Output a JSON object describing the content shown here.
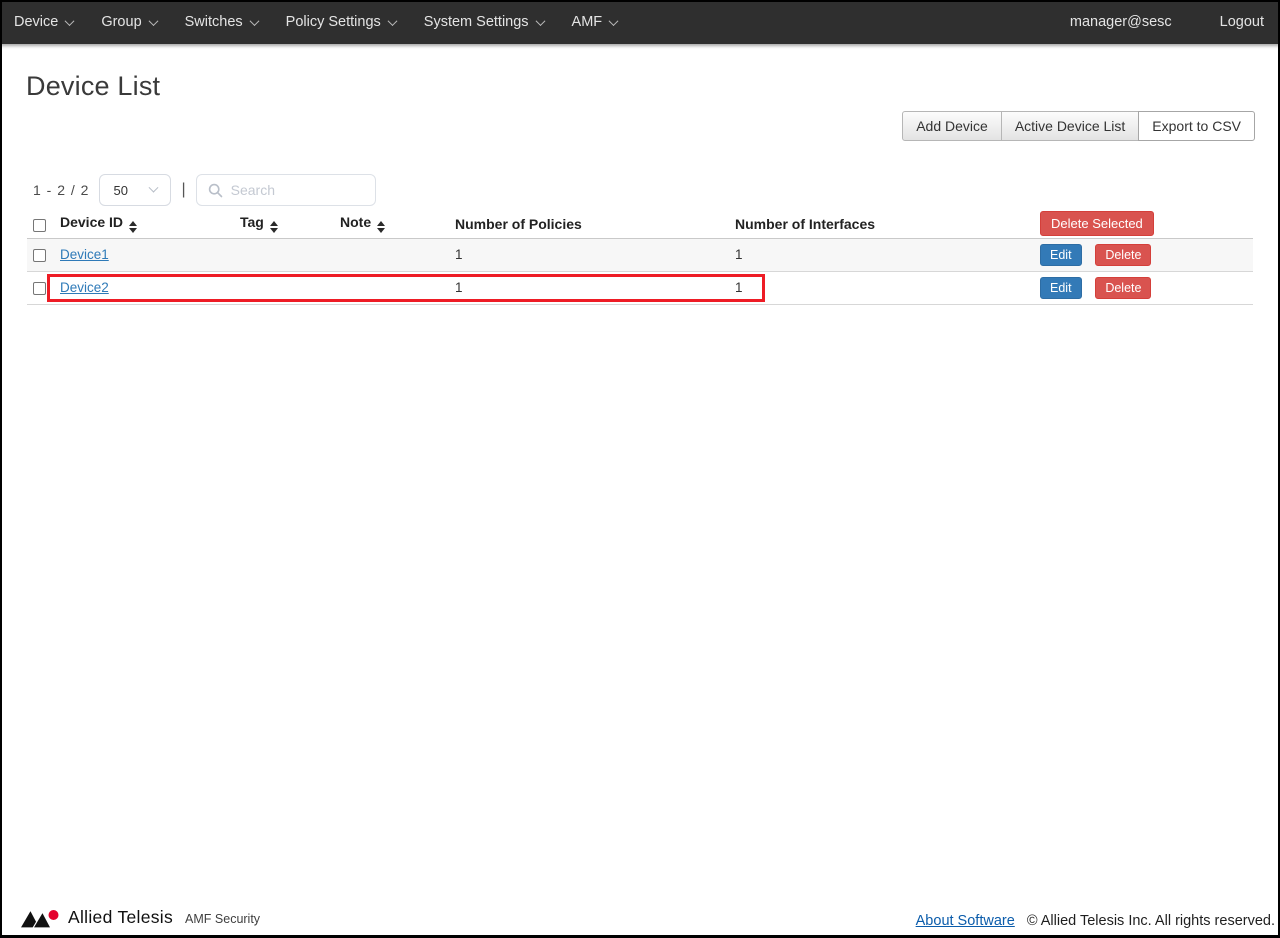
{
  "navbar": {
    "menus": [
      {
        "label": "Device"
      },
      {
        "label": "Group"
      },
      {
        "label": "Switches"
      },
      {
        "label": "Policy Settings"
      },
      {
        "label": "System Settings"
      },
      {
        "label": "AMF"
      }
    ],
    "user_email": "manager@sesc",
    "logout_label": "Logout"
  },
  "page": {
    "title": "Device List"
  },
  "toolbar": {
    "add_device_label": "Add Device",
    "active_device_list_label": "Active Device List",
    "export_csv_label": "Export to CSV"
  },
  "list_controls": {
    "range_text": "1 - 2 / 2",
    "page_size_value": "50",
    "separator": "|",
    "search_placeholder": "Search"
  },
  "table": {
    "headers": {
      "device_id": "Device ID",
      "tag": "Tag",
      "note": "Note",
      "policies": "Number of Policies",
      "interfaces": "Number of Interfaces"
    },
    "delete_selected_label": "Delete Selected",
    "rows": [
      {
        "device_id": "Device1",
        "tag": "",
        "note": "",
        "policies": "1",
        "interfaces": "1",
        "edit_label": "Edit",
        "delete_label": "Delete"
      },
      {
        "device_id": "Device2",
        "tag": "",
        "note": "",
        "policies": "1",
        "interfaces": "1",
        "edit_label": "Edit",
        "delete_label": "Delete"
      }
    ]
  },
  "annotation": {
    "highlighted_row": "Device2",
    "color": "#ee1c25"
  },
  "footer": {
    "brand": "Allied Telesis",
    "product": "AMF Security",
    "about_link_label": "About Software",
    "copyright": "© Allied Telesis Inc. All rights reserved."
  },
  "icons": {
    "menu_caret": "chevron-down",
    "page_size_caret": "chevron-down",
    "search": "magnifier",
    "sort": "up-down-triangles",
    "logo": "allied-telesis-mark"
  },
  "colors": {
    "navbar_bg": "#2f2f2f",
    "edit_blue": "#337ab7",
    "delete_red": "#d9534f",
    "annotation_red": "#ee1c25",
    "link_blue": "#2e7ab8",
    "logo_red": "#e4032e"
  }
}
